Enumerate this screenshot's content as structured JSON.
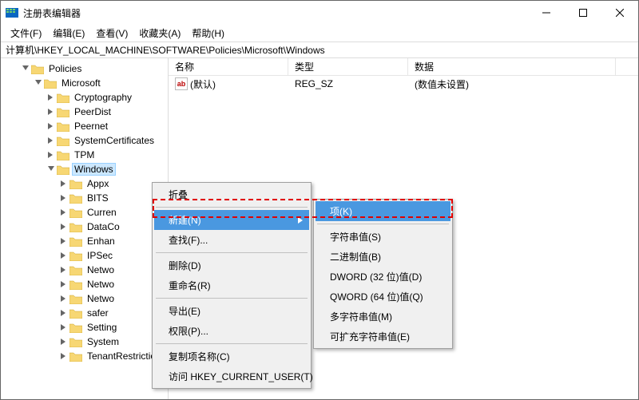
{
  "window": {
    "title": "注册表编辑器"
  },
  "menubar": [
    "文件(F)",
    "编辑(E)",
    "查看(V)",
    "收藏夹(A)",
    "帮助(H)"
  ],
  "pathbar": "计算机\\HKEY_LOCAL_MACHINE\\SOFTWARE\\Policies\\Microsoft\\Windows",
  "tree": {
    "root": "Policies",
    "child": "Microsoft",
    "grandchildren": [
      "Cryptography",
      "PeerDist",
      "Peernet",
      "SystemCertificates",
      "TPM",
      "Windows"
    ],
    "win_children_first": [
      "Appx",
      "BITS",
      "Curren",
      "DataCo",
      "Enhan",
      "IPSec",
      "Netwo",
      "Netwo",
      "Netwo",
      "safer",
      "Setting",
      "System",
      "TenantRestriction"
    ]
  },
  "list": {
    "cols": {
      "name": "名称",
      "type": "类型",
      "data": "数据"
    },
    "col_widths": {
      "name": 150,
      "type": 150,
      "data": 260
    },
    "rows": [
      {
        "name": "(默认)",
        "type": "REG_SZ",
        "data": "(数值未设置)"
      }
    ]
  },
  "menu1": {
    "collapse": "折叠",
    "new": "新建(N)",
    "find": "查找(F)...",
    "delete": "删除(D)",
    "rename": "重命名(R)",
    "export": "导出(E)",
    "perm": "权限(P)...",
    "copy": "复制项名称(C)",
    "goto": "访问 HKEY_CURRENT_USER(T)"
  },
  "menu2": {
    "key": "项(K)",
    "string": "字符串值(S)",
    "binary": "二进制值(B)",
    "dword": "DWORD (32 位)值(D)",
    "qword": "QWORD (64 位)值(Q)",
    "multi": "多字符串值(M)",
    "expand": "可扩充字符串值(E)"
  }
}
